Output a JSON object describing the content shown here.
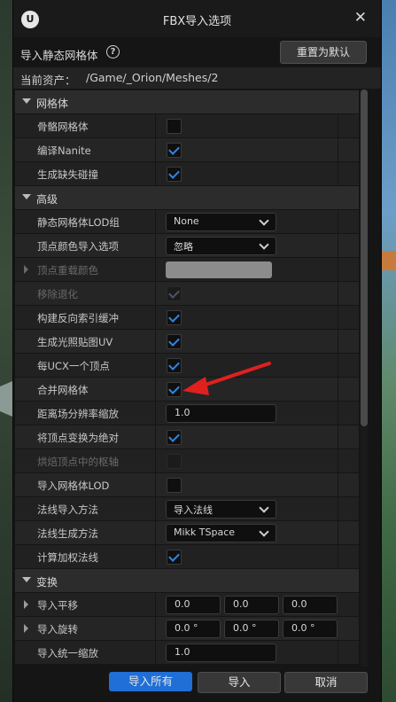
{
  "window": {
    "title": "FBX导入选项"
  },
  "header": {
    "label": "导入静态网格体",
    "reset_label": "重置为默认"
  },
  "asset": {
    "label": "当前资产：",
    "path": "/Game/_Orion/Meshes/2"
  },
  "sections": {
    "mesh": {
      "title": "网格体"
    },
    "advanced": {
      "title": "高级"
    },
    "transform": {
      "title": "变换"
    }
  },
  "mesh_rows": [
    {
      "label": "骨骼网格体",
      "checked": false
    },
    {
      "label": "编译Nanite",
      "checked": true
    },
    {
      "label": "生成缺失碰撞",
      "checked": true
    }
  ],
  "advanced_rows": {
    "lod_group": {
      "label": "静态网格体LOD组",
      "value": "None"
    },
    "vertex_color": {
      "label": "顶点颜色导入选项",
      "value": "忽略"
    },
    "override_color": {
      "label": "顶点重载颜色"
    },
    "remove_degenerates": {
      "label": "移除退化",
      "checked": true
    },
    "build_reversed_index": {
      "label": "构建反向索引缓冲",
      "checked": true
    },
    "generate_lightmap_uvs": {
      "label": "生成光照贴图UV",
      "checked": true
    },
    "one_convex_per_ucx": {
      "label": "每UCX一个顶点",
      "checked": true
    },
    "combine_meshes": {
      "label": "合并网格体",
      "checked": true
    },
    "distance_field_scale": {
      "label": "距离场分辨率缩放",
      "value": "1.0"
    },
    "transform_vertex_absolute": {
      "label": "将顶点变换为绝对",
      "checked": true
    },
    "bake_pivot": {
      "label": "烘焙顶点中的枢轴",
      "checked": false
    },
    "import_mesh_lods": {
      "label": "导入网格体LOD",
      "checked": false
    },
    "normal_import_method": {
      "label": "法线导入方法",
      "value": "导入法线"
    },
    "normal_generation_method": {
      "label": "法线生成方法",
      "value": "Mikk TSpace"
    },
    "compute_weighted_normals": {
      "label": "计算加权法线",
      "checked": true
    }
  },
  "transform_rows": {
    "translation": {
      "label": "导入平移",
      "x": "0.0",
      "y": "0.0",
      "z": "0.0"
    },
    "rotation": {
      "label": "导入旋转",
      "x": "0.0 °",
      "y": "0.0 °",
      "z": "0.0 °"
    },
    "scale": {
      "label": "导入统一缩放",
      "value": "1.0"
    }
  },
  "footer": {
    "import_all": "导入所有",
    "import": "导入",
    "cancel": "取消"
  },
  "colors": {
    "accent": "#1f6fd6",
    "check": "#2f86e0",
    "annotation_arrow": "#e0201f"
  }
}
